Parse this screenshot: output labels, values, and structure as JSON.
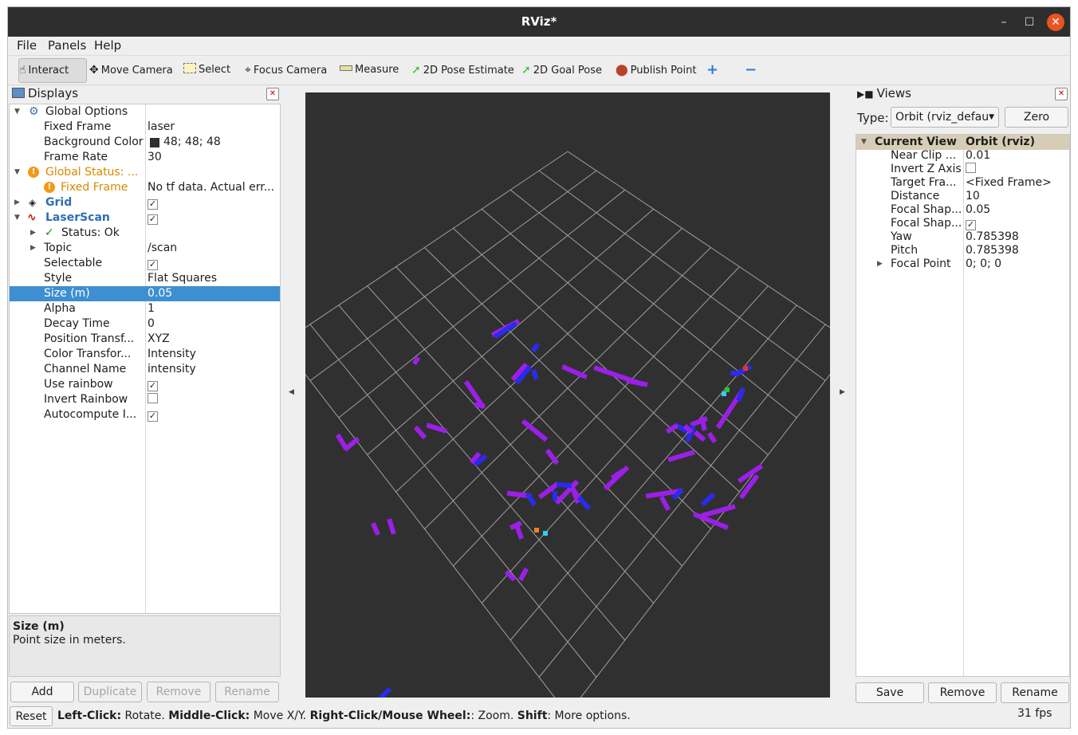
{
  "window": {
    "title": "RViz*",
    "minimize": "–",
    "maximize": "☐",
    "close": "✕"
  },
  "menu": [
    "File",
    "Panels",
    "Help"
  ],
  "toolbar": {
    "interact": "Interact",
    "move_camera": "Move Camera",
    "select": "Select",
    "focus_camera": "Focus Camera",
    "measure": "Measure",
    "pose_estimate": "2D Pose Estimate",
    "goal_pose": "2D Goal Pose",
    "publish_point": "Publish Point",
    "plus": "+",
    "minus": "−"
  },
  "displays": {
    "title": "Displays",
    "rows": [
      {
        "name": "Global Options",
        "value": ""
      },
      {
        "name": "Fixed Frame",
        "value": "laser"
      },
      {
        "name": "Background Color",
        "value": "48; 48; 48"
      },
      {
        "name": "Frame Rate",
        "value": "30"
      },
      {
        "name": "Global Status: ...",
        "value": ""
      },
      {
        "name": "Fixed Frame",
        "value": "No tf data.  Actual err..."
      },
      {
        "name": "Grid",
        "value": ""
      },
      {
        "name": "LaserScan",
        "value": ""
      },
      {
        "name": "Status: Ok",
        "value": ""
      },
      {
        "name": "Topic",
        "value": "/scan"
      },
      {
        "name": "Selectable",
        "value": ""
      },
      {
        "name": "Style",
        "value": "Flat Squares"
      },
      {
        "name": "Size (m)",
        "value": "0.05"
      },
      {
        "name": "Alpha",
        "value": "1"
      },
      {
        "name": "Decay Time",
        "value": "0"
      },
      {
        "name": "Position Transf...",
        "value": "XYZ"
      },
      {
        "name": "Color Transfor...",
        "value": "Intensity"
      },
      {
        "name": "Channel Name",
        "value": "intensity"
      },
      {
        "name": "Use rainbow",
        "value": ""
      },
      {
        "name": "Invert Rainbow",
        "value": ""
      },
      {
        "name": "Autocompute I...",
        "value": ""
      }
    ],
    "desc_title": "Size (m)",
    "desc_text": "Point size in meters.",
    "buttons": {
      "add": "Add",
      "duplicate": "Duplicate",
      "remove": "Remove",
      "rename": "Rename"
    }
  },
  "views": {
    "title": "Views",
    "type_label": "Type:",
    "type_value": "Orbit (rviz_defau",
    "zero": "Zero",
    "header": {
      "name": "Current View",
      "value": "Orbit (rviz)"
    },
    "rows": [
      {
        "name": "Near Clip ...",
        "value": "0.01"
      },
      {
        "name": "Invert Z Axis",
        "value": ""
      },
      {
        "name": "Target Fra...",
        "value": "<Fixed Frame>"
      },
      {
        "name": "Distance",
        "value": "10"
      },
      {
        "name": "Focal Shap...",
        "value": "0.05"
      },
      {
        "name": "Focal Shap...",
        "value": ""
      },
      {
        "name": "Yaw",
        "value": "0.785398"
      },
      {
        "name": "Pitch",
        "value": "0.785398"
      },
      {
        "name": "Focal Point",
        "value": "0; 0; 0"
      }
    ],
    "buttons": {
      "save": "Save",
      "remove": "Remove",
      "rename": "Rename"
    }
  },
  "status": {
    "reset": "Reset",
    "b1": "Left-Click:",
    "t1": " Rotate. ",
    "b2": "Middle-Click:",
    "t2": " Move X/Y. ",
    "b3": "Right-Click/Mouse Wheel:",
    "t3": ": Zoom. ",
    "b4": "Shift",
    "t4": ": More options.",
    "fps": "31 fps"
  },
  "colors": {
    "background": "#303030",
    "grid": "#a0a0a0",
    "scan_main": "#9b1fe8",
    "scan_blue": "#2a2af0"
  }
}
